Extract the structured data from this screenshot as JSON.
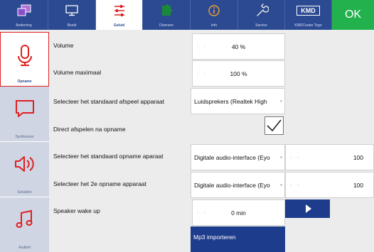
{
  "tabs": [
    {
      "label": "Bediening",
      "icon": "window-icon"
    },
    {
      "label": "Beeld",
      "icon": "monitor-icon"
    },
    {
      "label": "Geluid",
      "icon": "sliders-icon"
    },
    {
      "label": "Diversen",
      "icon": "puzzle-icon"
    },
    {
      "label": "Info",
      "icon": "info-icon"
    },
    {
      "label": "Service",
      "icon": "wrench-icon"
    },
    {
      "label": "KMDCreate Togo",
      "icon": "kmd-logo",
      "logo_text": "KMD"
    },
    {
      "label": "OK"
    }
  ],
  "sidebar": [
    {
      "label": "Opname",
      "icon": "microphone-icon"
    },
    {
      "label": "Synthesizer",
      "icon": "speech-bubble-icon"
    },
    {
      "label": "Geluiden",
      "icon": "speaker-icon"
    },
    {
      "label": "Auditief",
      "icon": "music-note-icon"
    }
  ],
  "settings": {
    "volume": {
      "label": "Volume",
      "value": "40 %"
    },
    "volume_max": {
      "label": "Volume maximaal",
      "value": "100 %"
    },
    "playback_device": {
      "label": "Selecteer het standaard afspeel apparaat",
      "value": "Luidsprekers (Realtek High"
    },
    "direct_play": {
      "label": "Direct afspelen na opname",
      "checked": true
    },
    "record_device": {
      "label": "Selecteer het standaard opname aparaat",
      "value": "Digitale audio-interface (Eyo",
      "level": "100"
    },
    "record_device2": {
      "label": "Selecteer het 2e opname apparaat",
      "value": "Digitale audio-interface (Eyo",
      "level": "100"
    },
    "speaker_wake": {
      "label": "Speaker wake up",
      "value": "0 min"
    },
    "mp3_import": {
      "label": "Mp3 importeren"
    }
  },
  "colors": {
    "topbar": "#2c4a92",
    "ok_green": "#22b14c",
    "accent_red": "#e02020",
    "button_blue": "#1e3c8c"
  }
}
